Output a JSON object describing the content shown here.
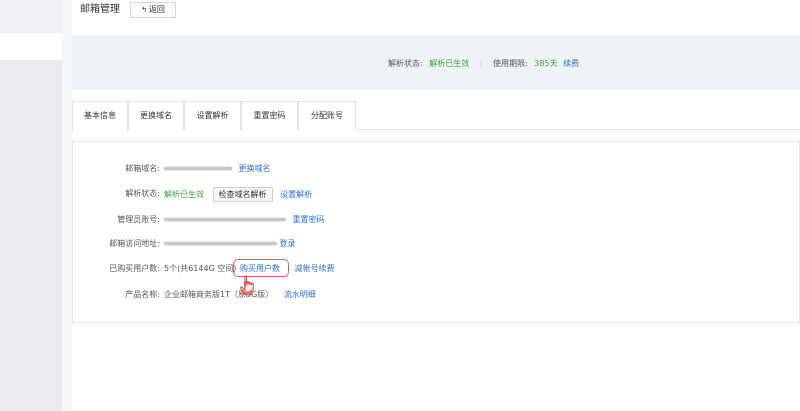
{
  "header": {
    "title": "邮箱管理",
    "back_label": "返回",
    "back_icon": "return-arrow-icon"
  },
  "status": {
    "resolve_label": "解析状态:",
    "resolve_value": "解析已生效",
    "period_label": "使用期限:",
    "period_value": "385天",
    "renew_link": "续费"
  },
  "tabs": [
    {
      "label": "基本信息",
      "active": true
    },
    {
      "label": "更换域名",
      "active": false
    },
    {
      "label": "设置解析",
      "active": false
    },
    {
      "label": "重置密码",
      "active": false
    },
    {
      "label": "分配账号",
      "active": false
    }
  ],
  "info": {
    "domain": {
      "label": "邮箱域名:",
      "link": "更换域名"
    },
    "resolve": {
      "label": "解析状态:",
      "value": "解析已生效",
      "button": "检查域名解析",
      "link": "设置解析"
    },
    "admin": {
      "label": "管理员账号:",
      "link": "重置密码"
    },
    "access": {
      "label": "邮箱访问地址:",
      "link": "登录"
    },
    "users": {
      "label": "已购买用户数:",
      "value": "5个(共6144G 空间)",
      "buy_link": "购买用户数",
      "reduce_link": "减帐号续费"
    },
    "product": {
      "label": "产品名称:",
      "value": "企业邮箱商务版1T（原3G版）",
      "link": "流水明细"
    }
  },
  "colors": {
    "link": "#2d6fd0",
    "success": "#3aa335",
    "highlight": "#e06060"
  }
}
